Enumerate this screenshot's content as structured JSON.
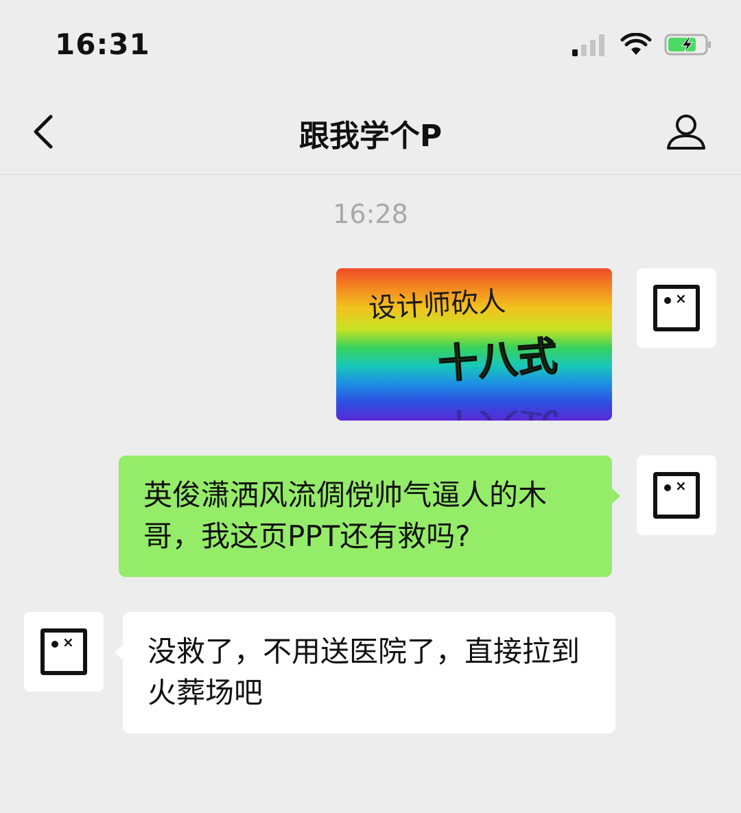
{
  "status_bar": {
    "time": "16:31",
    "signal_icon": "cellular-signal-icon",
    "wifi_icon": "wifi-icon",
    "battery_icon": "battery-charging-icon",
    "battery_color": "#4cd964"
  },
  "header": {
    "title": "跟我学个P",
    "back_icon": "chevron-left-icon",
    "profile_icon": "person-icon"
  },
  "chat": {
    "timestamp": "16:28",
    "messages": [
      {
        "side": "sent",
        "type": "image",
        "image_text_line1": "设计师砍人",
        "image_text_line2": "十八式"
      },
      {
        "side": "sent",
        "type": "text",
        "text": "英俊潇洒风流倜傥帅气逼人的木哥，我这页PPT还有救吗?"
      },
      {
        "side": "received",
        "type": "text",
        "text": "没救了，不用送医院了，直接拉到火葬场吧"
      }
    ],
    "sent_bubble_color": "#95ec69",
    "received_bubble_color": "#ffffff"
  }
}
